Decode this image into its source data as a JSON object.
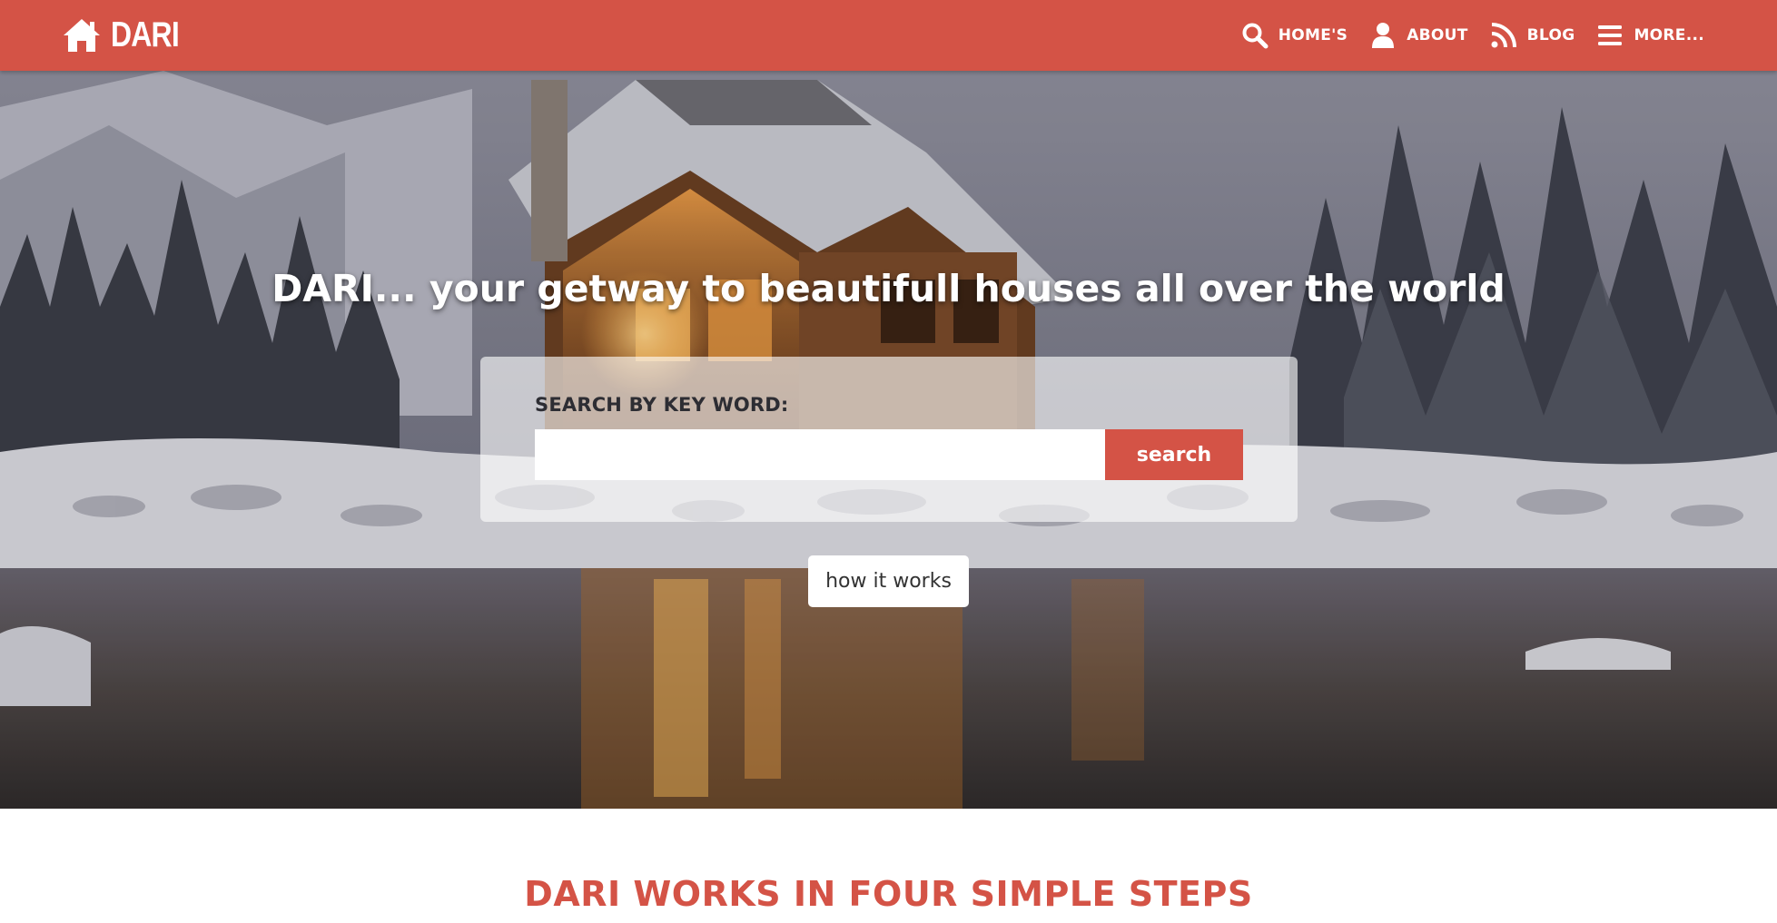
{
  "brand": {
    "name": "DARI",
    "icon": "home-icon",
    "color": "#d45346"
  },
  "nav": {
    "items": [
      {
        "label": "HOME'S",
        "icon": "search-icon"
      },
      {
        "label": "ABOUT",
        "icon": "user-icon"
      },
      {
        "label": "BLOG",
        "icon": "rss-icon"
      },
      {
        "label": "MORE...",
        "icon": "menu-icon"
      }
    ]
  },
  "hero": {
    "title": "DARI... your getway to beautifull houses all over the world",
    "search": {
      "label": "SEARCH BY KEY WORD:",
      "placeholder": "",
      "value": "",
      "button_label": "search"
    },
    "how_button_label": "how it works"
  },
  "steps": {
    "title": "DARI WORKS IN FOUR SIMPLE STEPS"
  },
  "colors": {
    "accent": "#d45346",
    "white": "#ffffff",
    "text_dark": "#2d2d33"
  }
}
